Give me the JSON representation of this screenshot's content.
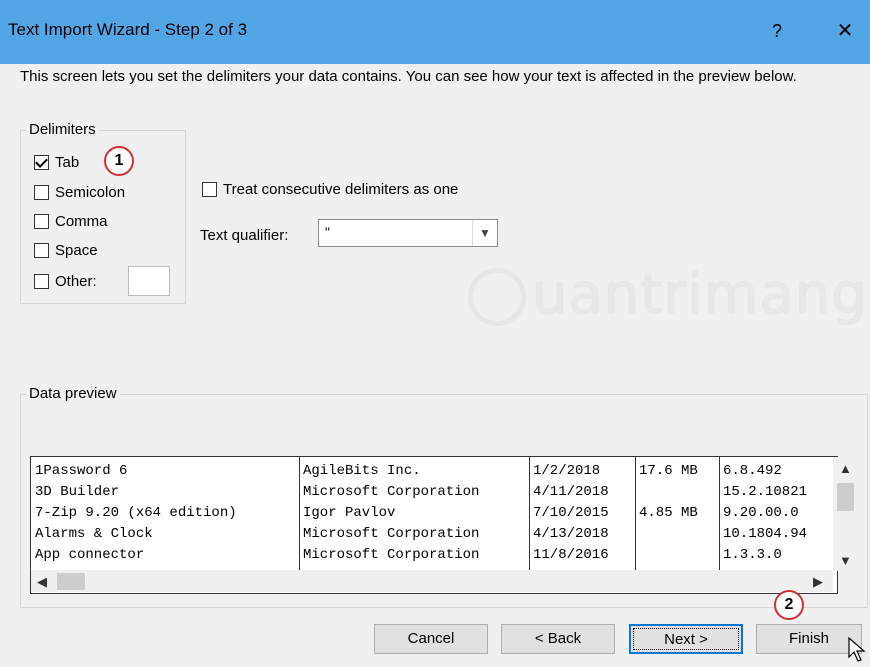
{
  "window": {
    "title": "Text Import Wizard - Step 2 of 3",
    "help": "?",
    "close": "✕"
  },
  "description": "This screen lets you set the delimiters your data contains.  You can see how your text is affected in the preview below.",
  "delimiters": {
    "legend": "Delimiters",
    "items": [
      {
        "label": "Tab",
        "checked": true
      },
      {
        "label": "Semicolon",
        "checked": false
      },
      {
        "label": "Comma",
        "checked": false
      },
      {
        "label": "Space",
        "checked": false
      },
      {
        "label": "Other:",
        "checked": false
      }
    ],
    "other_value": ""
  },
  "consecutive": {
    "label": "Treat consecutive delimiters as one",
    "checked": false
  },
  "qualifier": {
    "label": "Text qualifier:",
    "value": "\""
  },
  "watermark": "uantrimang",
  "preview": {
    "legend": "Data preview",
    "rows": [
      [
        "1Password 6",
        "AgileBits Inc.",
        "1/2/2018",
        "17.6 MB",
        "6.8.492"
      ],
      [
        "3D Builder",
        "Microsoft Corporation",
        "4/11/2018",
        "",
        "15.2.10821"
      ],
      [
        "7-Zip 9.20 (x64 edition)",
        "Igor Pavlov",
        "7/10/2015",
        "4.85 MB",
        "9.20.00.0"
      ],
      [
        "Alarms & Clock",
        "Microsoft Corporation",
        "4/13/2018",
        "",
        "10.1804.94"
      ],
      [
        "App connector",
        "Microsoft Corporation",
        "11/8/2016",
        "",
        "1.3.3.0"
      ]
    ]
  },
  "badges": {
    "one": "1",
    "two": "2"
  },
  "buttons": {
    "cancel": "Cancel",
    "back": "< Back",
    "next": "Next >",
    "finish": "Finish"
  },
  "colors": {
    "titlebar": "#53a6e6",
    "badge_border": "#d32f2f",
    "default_button": "#0078d7"
  }
}
